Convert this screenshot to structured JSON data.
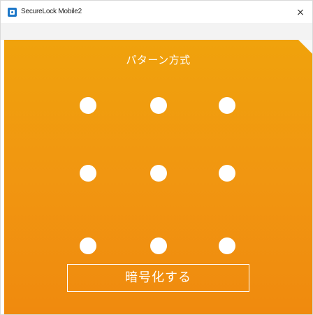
{
  "window": {
    "title": "SecureLock Mobile2",
    "icon": "securelock-app-icon",
    "close_glyph": "×"
  },
  "pattern": {
    "mode_title": "パターン方式",
    "grid": {
      "rows": 3,
      "cols": 3
    }
  },
  "actions": {
    "encrypt_label": "暗号化する"
  },
  "colors": {
    "panel_top": "#f0a20c",
    "panel_bottom": "#f08a0e",
    "dot": "#ffffff"
  }
}
